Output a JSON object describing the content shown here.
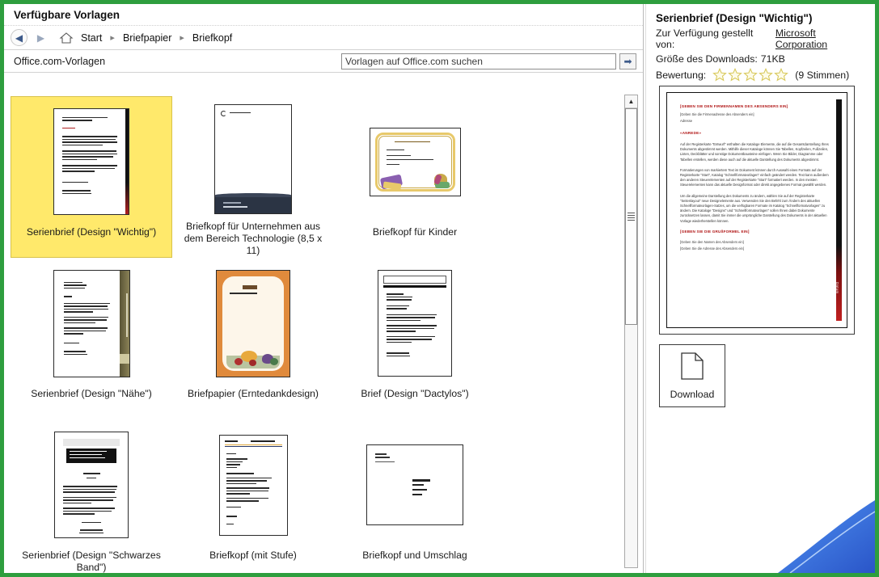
{
  "window": {
    "available_templates_title": "Verfügbare Vorlagen",
    "border_color": "#2e9e3e"
  },
  "nav": {
    "back_icon": "back-arrow-icon",
    "forward_icon": "forward-arrow-icon",
    "home_icon": "home-icon",
    "breadcrumbs": [
      {
        "label": "Start"
      },
      {
        "label": "Briefpapier"
      },
      {
        "label": "Briefkopf"
      }
    ],
    "separator": "▸"
  },
  "search": {
    "category_label": "Office.com-Vorlagen",
    "placeholder": "Vorlagen auf Office.com suchen",
    "value": "",
    "go_icon": "arrow-right-icon"
  },
  "grid": {
    "tiles": [
      {
        "label": "Serienbrief (Design \"Wichtig\")",
        "selected": true,
        "thumb": "letter-important"
      },
      {
        "label": "Briefkopf für Unternehmen aus dem Bereich Technologie (8,5 x 11)",
        "selected": false,
        "thumb": "tech-letterhead"
      },
      {
        "label": "Briefkopf für Kinder",
        "selected": false,
        "thumb": "kids-landscape"
      },
      {
        "label": "Serienbrief (Design \"Nähe\")",
        "selected": false,
        "thumb": "letter-naehe"
      },
      {
        "label": "Briefpapier (Erntedankdesign)",
        "selected": false,
        "thumb": "harvest"
      },
      {
        "label": "Brief (Design \"Dactylos\")",
        "selected": false,
        "thumb": "dactylos"
      },
      {
        "label": "Serienbrief (Design \"Schwarzes Band\")",
        "selected": false,
        "thumb": "black-band"
      },
      {
        "label": "Briefkopf (mit Stufe)",
        "selected": false,
        "thumb": "step-letterhead"
      },
      {
        "label": "Briefkopf und Umschlag",
        "selected": false,
        "thumb": "envelope"
      }
    ]
  },
  "scrollbar": {
    "up_icon": "scroll-up-arrow-icon",
    "grip_icon": "scroll-grip-icon"
  },
  "details": {
    "title": "Serienbrief (Design \"Wichtig\")",
    "provider_label": "Zur Verfügung gestellt von:",
    "provider_value": "Microsoft Corporation",
    "size_label": "Größe des Downloads:",
    "size_value": "71KB",
    "rating_label": "Bewertung:",
    "stars_total": 5,
    "stars_filled": 0,
    "votes_text": "(9 Stimmen)",
    "star_icon": "star-icon",
    "star_color": "#efe38a"
  },
  "preview": {
    "heading1": "[GEBEN SIE DEN FIRMENNAMEN DES ABSENDERS EIN]",
    "sub1": "[Geben Sie die Firmenadresse des Absenders ein]",
    "sub2": "Adresse",
    "heading2": "«ANREDE»",
    "para1": "Auf der Registerkarte \"Entwurf\" enthalten die Kataloge Elemente, die auf die Gesamtdarstellung Ihres Dokuments abgestimmt werden. Mithilfe dieser Kataloge können Sie Tabellen, Kopfzeilen, Fußzeilen, Listen, Deckblätter und sonstige Dokumentbausteine einfügen. Wenn Sie Bilder, Diagramme oder Tabellen erstellen, werden diese auch auf die aktuelle Darstellung des Dokuments abgestimmt.",
    "para2": "Formatierungen von markiertem Text im Dokument können durch Auswahl eines Formats auf der Registerkarte \"Start\", Katalog \"Schnellformatvorlagen\" einfach geändert werden. Text kann außerdem den anderen Steuerelementen auf der Registerkarte \"Start\" formatiert werden. In den meisten Steuerelementen kann das aktuelle Designformat oder direkt angegebenes Format gewählt werden.",
    "para3": "Um die allgemeine Darstellung des Dokuments zu ändern, wählen Sie auf der Registerkarte \"Seitenlayout\" neue Designelemente aus. Verwenden Sie den Befehl zum Ändern des aktuellen Schnellformatvorlagen-Satzes, um die verfügbaren Formate im Katalog \"Schnellformatvorlagen\" zu ändern. Die Kataloge \"Designs\" und \"Schnellformatvorlagen\" sollen Ihnen dabei Dokumente zurücksetzen lassen, damit Sie immer die ursprüngliche Darstellung des Dokuments in der aktuellen Vorlage wiederherstellen können.",
    "heading3": "[GEBEN SIE DIE GRUßFORMEL EIN]",
    "foot1": "[Geben Sie den Namen des Absenders ein]",
    "foot2": "[Geben Sie die Adresse des Absenders ein]",
    "sidebar_text": "Datum"
  },
  "download": {
    "label": "Download",
    "icon": "document-page-icon"
  }
}
